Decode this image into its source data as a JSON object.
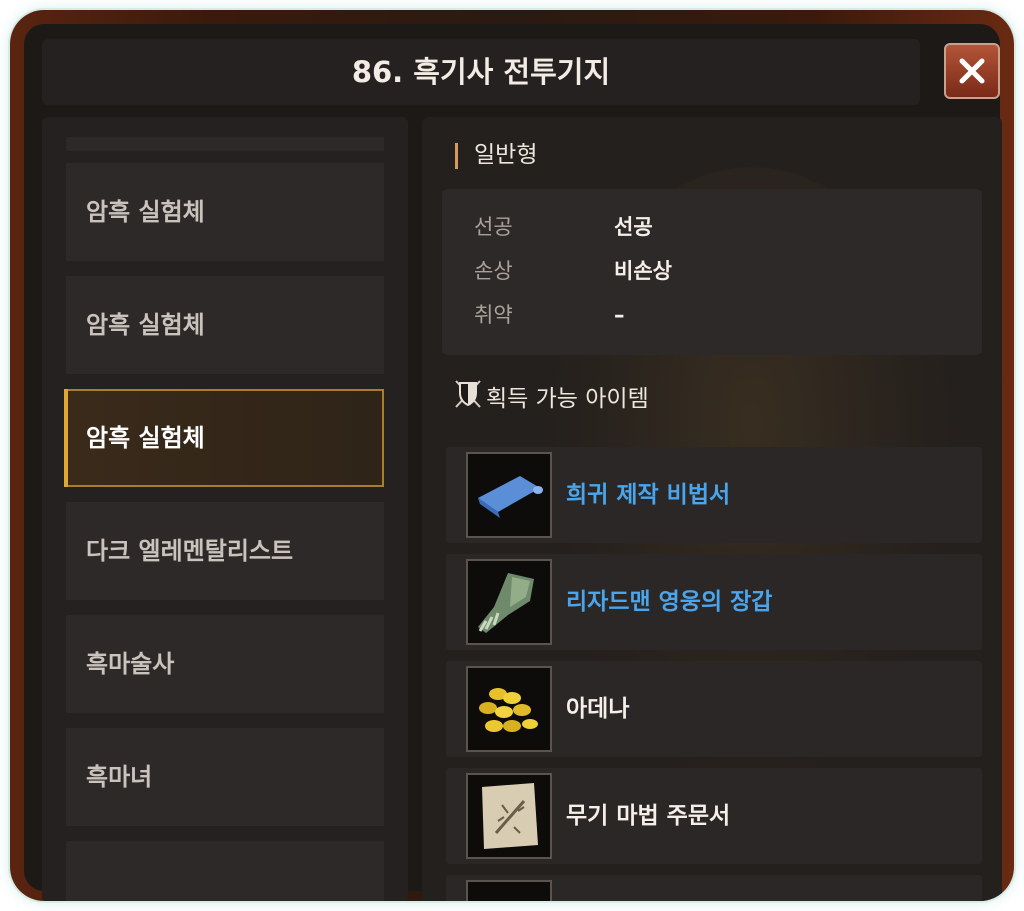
{
  "window": {
    "title": "86. 흑기사 전투기지",
    "close_icon": "close-icon"
  },
  "monster_list": [
    {
      "label": "암흑 실험체",
      "selected": false
    },
    {
      "label": "암흑 실험체",
      "selected": false
    },
    {
      "label": "암흑 실험체",
      "selected": true
    },
    {
      "label": "다크 엘레멘탈리스트",
      "selected": false
    },
    {
      "label": "흑마술사",
      "selected": false
    },
    {
      "label": "흑마녀",
      "selected": false
    }
  ],
  "detail": {
    "type_label": "일반형",
    "attributes": [
      {
        "key": "선공",
        "value": "선공"
      },
      {
        "key": "손상",
        "value": "비손상"
      },
      {
        "key": "취약",
        "value": "–"
      }
    ],
    "items_title": "획득 가능 아이템",
    "items": [
      {
        "name": "희귀 제작 비법서",
        "icon": "scroll-blueprint-icon",
        "color": "#4aa5ec"
      },
      {
        "name": "리자드맨 영웅의 장갑",
        "icon": "gauntlet-icon",
        "color": "#4aa5ec"
      },
      {
        "name": "아데나",
        "icon": "gold-coins-icon",
        "color": "#f4efe8"
      },
      {
        "name": "무기 마법 주문서",
        "icon": "parchment-scroll-icon",
        "color": "#f4efe8"
      }
    ]
  },
  "colors": {
    "accent_gold": "#e0a830",
    "rare_item_blue": "#4aa5ec",
    "close_button": "#a04a30"
  }
}
